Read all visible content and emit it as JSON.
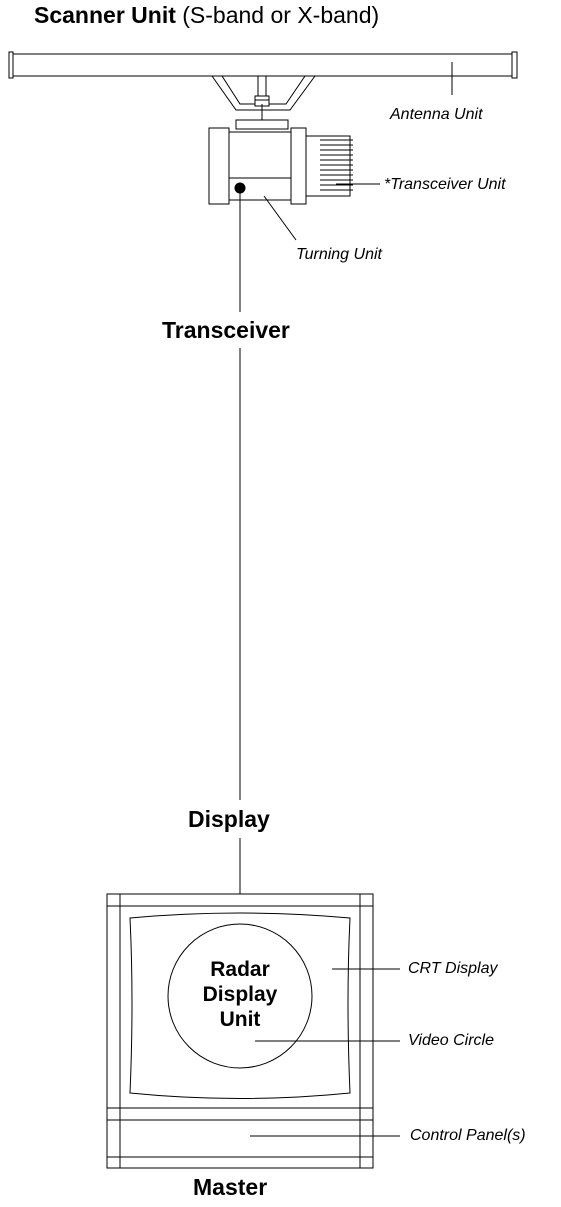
{
  "title": {
    "bold": "Scanner Unit",
    "normal": " (S-band or X-band)"
  },
  "callouts": {
    "antenna_unit": "Antenna Unit",
    "transceiver_unit": "*Transceiver Unit",
    "turning_unit": "Turning Unit",
    "crt_display": "CRT Display",
    "video_circle": "Video Circle",
    "control_panel": "Control Panel(s)"
  },
  "sections": {
    "transceiver": "Transceiver",
    "display": "Display",
    "master": "Master"
  },
  "radar_unit": {
    "line1": "Radar",
    "line2": "Display",
    "line3": "Unit"
  }
}
